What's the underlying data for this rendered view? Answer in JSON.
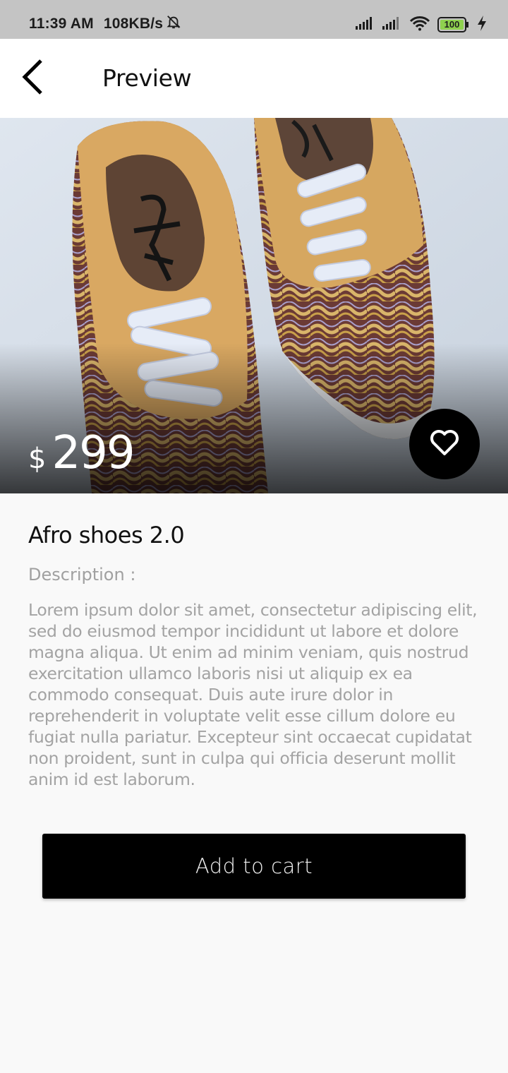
{
  "status_bar": {
    "time": "11:39 AM",
    "speed": "108KB/s",
    "battery": "100"
  },
  "app_bar": {
    "title": "Preview"
  },
  "product": {
    "currency": "$",
    "price": "299",
    "name": "Afro shoes 2.0",
    "description_label": "Description :",
    "description": "Lorem ipsum dolor sit amet, consectetur adipiscing elit, sed do eiusmod tempor incididunt ut labore et dolore magna aliqua. Ut enim ad minim veniam, quis nostrud exercitation ullamco laboris nisi ut aliquip ex ea commodo consequat. Duis aute irure dolor in reprehenderit in voluptate velit esse cillum dolore eu fugiat nulla pariatur. Excepteur sint occaecat cupidatat non proident, sunt in culpa qui officia deserunt mollit anim id est laborum."
  },
  "actions": {
    "add_to_cart": "Add to cart"
  },
  "colors": {
    "status_bar_bg": "#c4c4c4",
    "app_bar_bg": "#ffffff",
    "page_bg": "#f9f9f9",
    "button_bg": "#000000",
    "battery_fill": "#8fd14f",
    "description_text": "#a3a3a3"
  }
}
